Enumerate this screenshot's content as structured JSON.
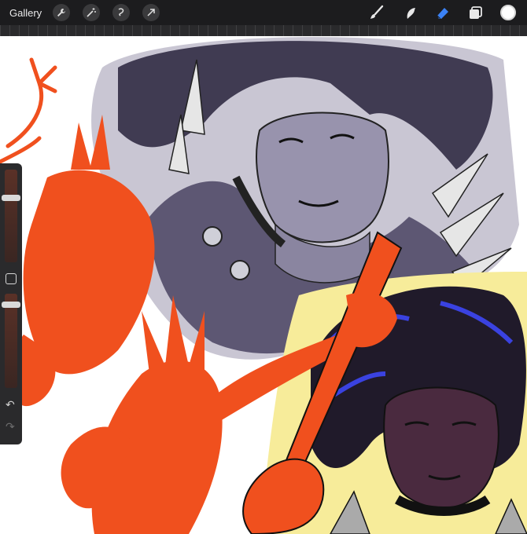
{
  "toolbar": {
    "gallery_label": "Gallery",
    "left_tools": [
      "wrench-icon",
      "magic-wand-icon",
      "selection-icon",
      "transform-arrow-icon"
    ],
    "right_tools": [
      "brush-icon",
      "smudge-icon",
      "eraser-icon",
      "layers-icon",
      "color-swatch"
    ]
  },
  "colors": {
    "toolbar_bg": "#1c1c1e",
    "eraser_active": "#3b82f6",
    "current_color": "#ffffff",
    "sketch_red": "#f0501e",
    "portrait_purple": "#7a7491",
    "hair_dark": "#201a2a",
    "hair_highlight": "#3a42e0",
    "halo_yellow": "#f7ec9a"
  },
  "sidebar": {
    "brush_size_icon": "slider-handle",
    "opacity_icon": "slider-handle",
    "modify_button": "square-icon",
    "undo_icon": "undo-icon",
    "redo_icon": "redo-icon"
  }
}
